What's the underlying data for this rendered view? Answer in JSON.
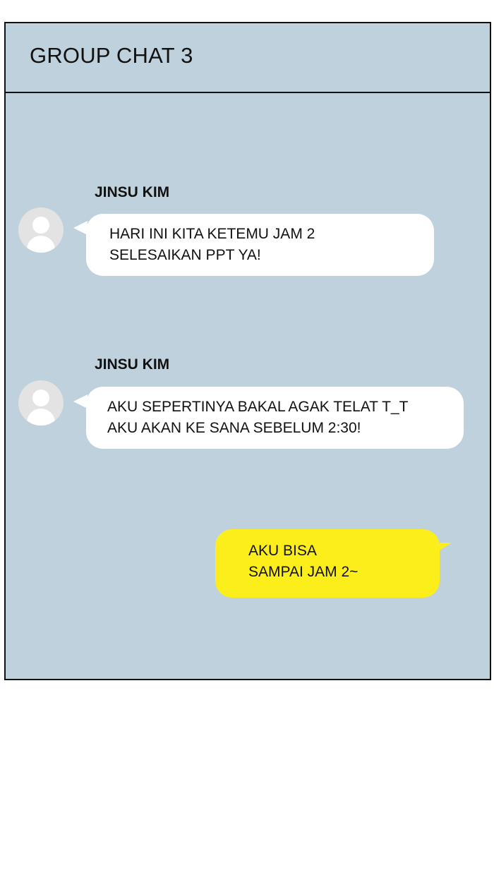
{
  "header": {
    "title": "GROUP CHAT 3"
  },
  "messages": [
    {
      "sender": "JINSU KIM",
      "avatar_icon": "user-avatar-icon",
      "lines": [
        "HARI INI KITA KETEMU JAM 2",
        "SELESAIKAN PPT YA!"
      ]
    },
    {
      "sender": "JINSU KIM",
      "avatar_icon": "user-avatar-icon",
      "lines": [
        "AKU SEPERTINYA BAKAL AGAK TELAT T_T",
        "AKU AKAN KE SANA SEBELUM 2:30!"
      ]
    },
    {
      "sender": "",
      "lines": [
        "AKU BISA",
        "SAMPAI JAM 2~"
      ]
    }
  ],
  "colors": {
    "chat_background": "#bfd1dd",
    "incoming_bubble": "#ffffff",
    "outgoing_bubble": "#fcee1b",
    "avatar_background": "#e3e3e3",
    "border": "#111111"
  }
}
